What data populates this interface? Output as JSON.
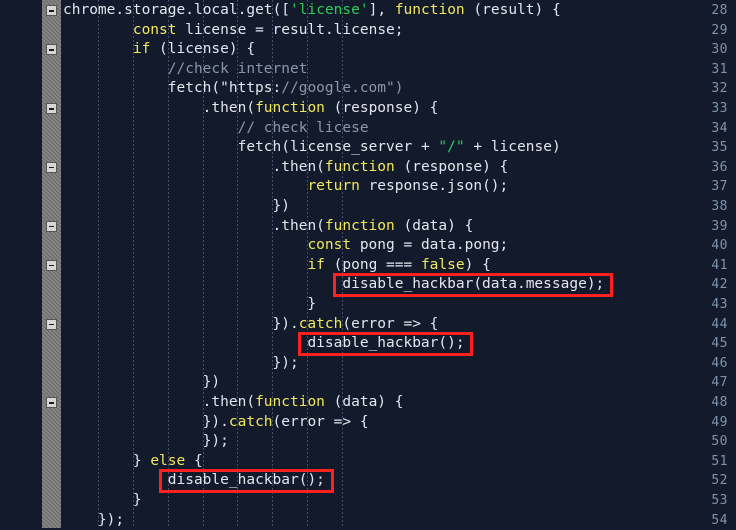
{
  "editor": {
    "title": "code-editor",
    "language": "javascript",
    "first_line": 28,
    "last_line": 54,
    "colors": {
      "background": "#131a2b",
      "gutter_band": "#6e6e6e",
      "line_number": "#7f93ad",
      "keyword": "#f2e85c",
      "string": "#2ecc55",
      "comment": "#8a97ab",
      "plain": "#e3e6ef",
      "highlight_box": "#ff2020"
    }
  },
  "line_numbers": [
    28,
    29,
    30,
    31,
    32,
    33,
    34,
    35,
    36,
    37,
    38,
    39,
    40,
    41,
    42,
    43,
    44,
    45,
    46,
    47,
    48,
    49,
    50,
    51,
    52,
    53,
    54
  ],
  "fold_markers": [
    {
      "line": 28,
      "icon": "fold-collapse-icon"
    },
    {
      "line": 30,
      "icon": "fold-collapse-icon"
    },
    {
      "line": 33,
      "icon": "fold-collapse-icon"
    },
    {
      "line": 36,
      "icon": "fold-collapse-icon"
    },
    {
      "line": 39,
      "icon": "fold-collapse-icon"
    },
    {
      "line": 41,
      "icon": "fold-collapse-icon"
    },
    {
      "line": 44,
      "icon": "fold-collapse-icon"
    },
    {
      "line": 48,
      "icon": "fold-collapse-icon"
    }
  ],
  "code_lines": [
    {
      "n": 28,
      "text": "chrome.storage.local.get(['license'], function (result) {"
    },
    {
      "n": 29,
      "text": "        const license = result.license;"
    },
    {
      "n": 30,
      "text": "        if (license) {"
    },
    {
      "n": 31,
      "text": "            //check internet"
    },
    {
      "n": 32,
      "text": "            fetch(\"https://google.com\")"
    },
    {
      "n": 33,
      "text": "                .then(function (response) {"
    },
    {
      "n": 34,
      "text": "                    // check licese"
    },
    {
      "n": 35,
      "text": "                    fetch(license_server + \"/\" + license)"
    },
    {
      "n": 36,
      "text": "                        .then(function (response) {"
    },
    {
      "n": 37,
      "text": "                            return response.json();"
    },
    {
      "n": 38,
      "text": "                        })"
    },
    {
      "n": 39,
      "text": "                        .then(function (data) {"
    },
    {
      "n": 40,
      "text": "                            const pong = data.pong;"
    },
    {
      "n": 41,
      "text": "                            if (pong === false) {"
    },
    {
      "n": 42,
      "text": "                                disable_hackbar(data.message);"
    },
    {
      "n": 43,
      "text": "                            }"
    },
    {
      "n": 44,
      "text": "                        }).catch(error => {"
    },
    {
      "n": 45,
      "text": "                            disable_hackbar();"
    },
    {
      "n": 46,
      "text": "                        });"
    },
    {
      "n": 47,
      "text": "                })"
    },
    {
      "n": 48,
      "text": "                .then(function (data) {"
    },
    {
      "n": 49,
      "text": "                }).catch(error => {"
    },
    {
      "n": 50,
      "text": "                });"
    },
    {
      "n": 51,
      "text": "        } else {"
    },
    {
      "n": 52,
      "text": "            disable_hackbar();"
    },
    {
      "n": 53,
      "text": "        }"
    },
    {
      "n": 54,
      "text": "    });"
    }
  ],
  "highlights": [
    {
      "label": "disable_hackbar(data.message);",
      "line": 42
    },
    {
      "label": "disable_hackbar();",
      "line": 45
    },
    {
      "label": "disable_hackbar();",
      "line": 52
    }
  ]
}
